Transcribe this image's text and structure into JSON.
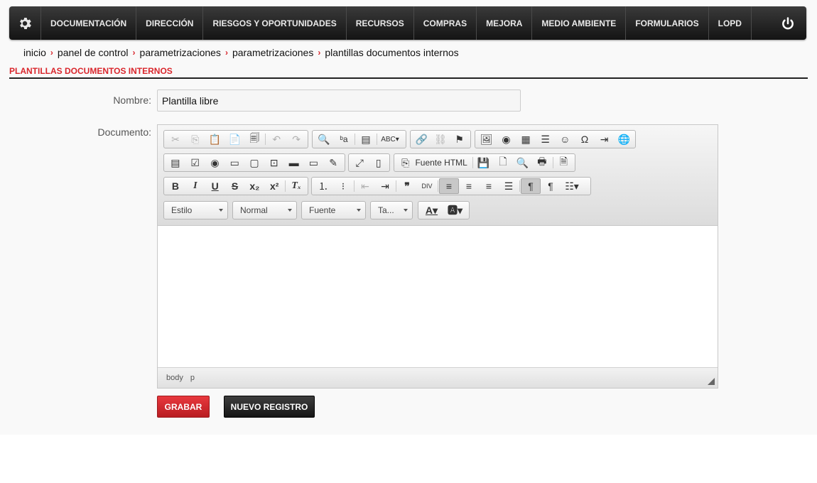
{
  "nav": {
    "items": [
      {
        "label": "DOCUMENTACIÓN",
        "name": "nav-documentacion"
      },
      {
        "label": "DIRECCIÓN",
        "name": "nav-direccion"
      },
      {
        "label": "RIESGOS Y OPORTUNIDADES",
        "name": "nav-riesgos"
      },
      {
        "label": "RECURSOS",
        "name": "nav-recursos"
      },
      {
        "label": "COMPRAS",
        "name": "nav-compras"
      },
      {
        "label": "MEJORA",
        "name": "nav-mejora"
      },
      {
        "label": "MEDIO AMBIENTE",
        "name": "nav-medio-ambiente"
      },
      {
        "label": "FORMULARIOS",
        "name": "nav-formularios"
      },
      {
        "label": "LOPD",
        "name": "nav-lopd"
      }
    ],
    "icons": [
      "gear-icon",
      "power-icon"
    ]
  },
  "breadcrumb": [
    "inicio",
    "panel de control",
    "parametrizaciones",
    "parametrizaciones",
    "plantillas documentos internos"
  ],
  "page": {
    "title": "PLANTILLAS DOCUMENTOS INTERNOS"
  },
  "form": {
    "nombre_label": "Nombre:",
    "nombre_value": "Plantilla libre",
    "documento_label": "Documento:"
  },
  "editor": {
    "source_label": "Fuente HTML",
    "combos": [
      "Estilo",
      "Normal",
      "Fuente",
      "Ta..."
    ],
    "format_buttons": {
      "bold": "B",
      "italic": "I",
      "underline": "U",
      "strike": "S"
    },
    "path": [
      "body",
      "p"
    ]
  },
  "buttons": {
    "save": "GRABAR",
    "new": "NUEVO REGISTRO"
  },
  "colors": {
    "accent": "#d9262c",
    "navbar": "#1e1e1e"
  }
}
